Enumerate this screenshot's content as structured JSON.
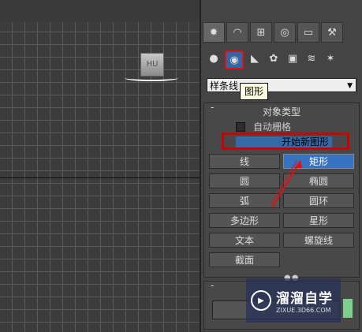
{
  "viewport": {
    "teapot_label": "HU"
  },
  "panel": {
    "tabs": [
      "✸",
      "◠",
      "⊞",
      "◎",
      "▭",
      "⚒"
    ],
    "subtabs": [
      "●",
      "◉",
      "◣",
      "✿",
      "▣",
      "≋",
      "✶"
    ],
    "dropdown": {
      "value": "样条线",
      "arrow": "▼"
    },
    "tooltip": "图形",
    "object_type": {
      "title": "对象类型",
      "collapse": "-",
      "auto_grid": "自动栅格",
      "start_new_shape": "开始新图形",
      "buttons": [
        "线",
        "矩形",
        "圆",
        "椭圆",
        "弧",
        "圆环",
        "多边形",
        "星形",
        "文本",
        "螺旋线",
        "截面"
      ]
    },
    "second_rollout_collapse": "-"
  },
  "colors": {
    "active_button": "#3872c2",
    "highlight": "#cc0000"
  },
  "watermark": {
    "logo_glyph": "▶",
    "title": "溜溜自学",
    "url": "ZIXUE.3D66.COM"
  }
}
